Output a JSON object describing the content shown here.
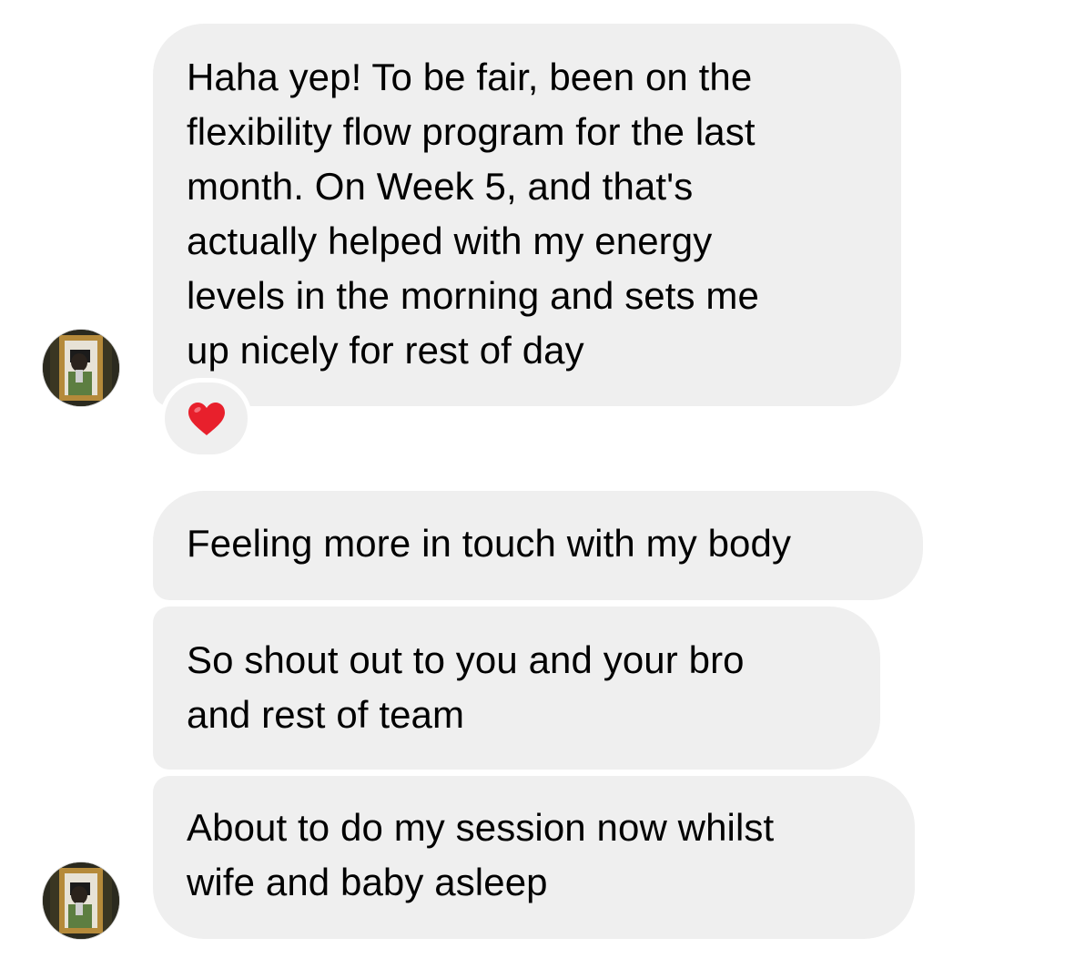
{
  "messages": [
    {
      "id": "m1",
      "lines": [
        "Haha yep! To be fair, been on the",
        "flexibility flow program for the last",
        "month. On Week 5, and that's",
        "actually helped with my energy",
        "levels in the morning and sets me",
        "up nicely for rest of day"
      ],
      "reaction": "heart-icon"
    },
    {
      "id": "m2",
      "lines": [
        "Feeling more in touch with my body"
      ]
    },
    {
      "id": "m3",
      "lines": [
        "So shout out to you and your bro",
        "and rest of team"
      ]
    },
    {
      "id": "m4",
      "lines": [
        "About to do my session now whilst",
        "wife and baby asleep"
      ]
    }
  ],
  "colors": {
    "bubble_background": "#efefef",
    "text": "#000000",
    "reaction_heart": "#e8202c",
    "page_background": "#ffffff"
  }
}
